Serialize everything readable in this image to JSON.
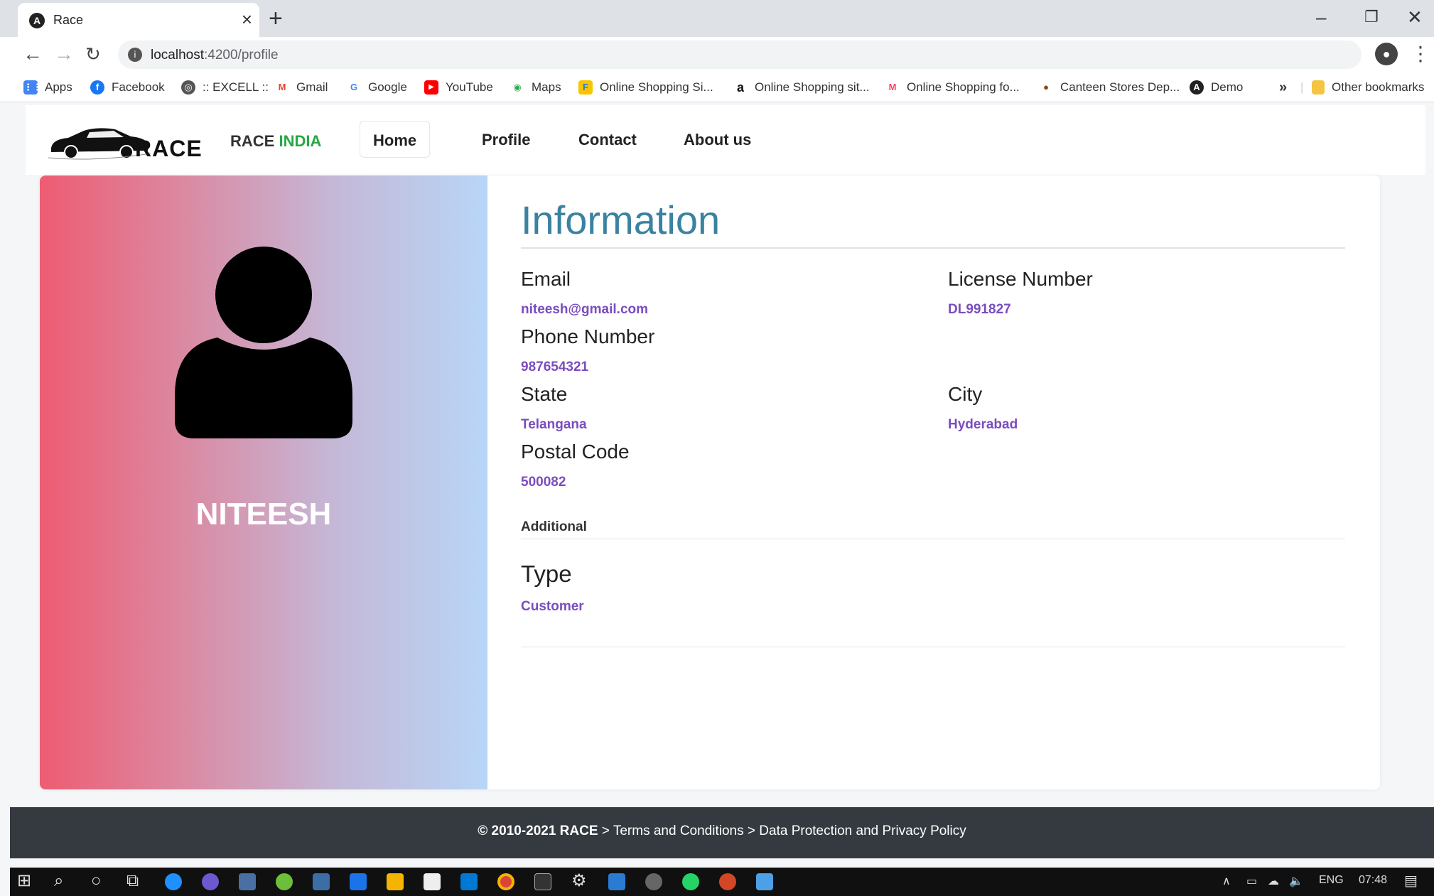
{
  "browser": {
    "tab_title": "Race",
    "tab_favicon": "A",
    "url_host": "localhost",
    "url_path": ":4200/profile",
    "bookmarks": [
      {
        "label": "Apps",
        "icon": "apps-grid-icon",
        "color": "#4285f4",
        "glyph": "⋮⋮"
      },
      {
        "label": "Facebook",
        "icon": "facebook-icon",
        "color": "#1877f2",
        "glyph": "f"
      },
      {
        "label": ":: EXCELL ::",
        "icon": "globe-icon",
        "color": "#555555",
        "glyph": "◎"
      },
      {
        "label": "Gmail",
        "icon": "gmail-icon",
        "color": "#ea4335",
        "glyph": "M"
      },
      {
        "label": "Google",
        "icon": "google-icon",
        "color": "#4285f4",
        "glyph": "G"
      },
      {
        "label": "YouTube",
        "icon": "youtube-icon",
        "color": "#ff0000",
        "glyph": "▶"
      },
      {
        "label": "Maps",
        "icon": "maps-icon",
        "color": "#34a853",
        "glyph": "◉"
      },
      {
        "label": "Online Shopping Si...",
        "icon": "flipkart-icon",
        "color": "#f7c600",
        "glyph": "F"
      },
      {
        "label": "Online Shopping sit...",
        "icon": "amazon-icon",
        "color": "#111111",
        "glyph": "a"
      },
      {
        "label": "Online Shopping fo...",
        "icon": "myntra-icon",
        "color": "#ff3f6c",
        "glyph": "M"
      },
      {
        "label": "Canteen Stores Dep...",
        "icon": "csd-icon",
        "color": "#8b4513",
        "glyph": "●"
      },
      {
        "label": "Demo",
        "icon": "angular-icon",
        "color": "#222222",
        "glyph": "A"
      }
    ],
    "bookmarks_overflow": "»",
    "other_bookmarks": "Other bookmarks"
  },
  "app": {
    "logo_text": "RACE",
    "brand_prefix": "RACE",
    "brand_accent": "INDIA",
    "nav": [
      {
        "label": "Home",
        "active": true
      },
      {
        "label": "Profile",
        "active": false
      },
      {
        "label": "Contact",
        "active": false
      },
      {
        "label": "About us",
        "active": false
      }
    ]
  },
  "profile": {
    "name": "NITEESH",
    "section_title": "Information",
    "fields": {
      "email_label": "Email",
      "email_value": "niteesh@gmail.com",
      "license_label": "License Number",
      "license_value": "DL991827",
      "phone_label": "Phone Number",
      "phone_value": "987654321",
      "state_label": "State",
      "state_value": "Telangana",
      "city_label": "City",
      "city_value": "Hyderabad",
      "postal_label": "Postal Code",
      "postal_value": "500082"
    },
    "additional_title": "Additional",
    "type_label": "Type",
    "type_value": "Customer"
  },
  "footer": {
    "copyright": "© 2010-2021 RACE",
    "link1": "Terms and Conditions",
    "link2": "Data Protection and Privacy Policy",
    "separator": ">"
  },
  "taskbar": {
    "language": "ENG",
    "time": "07:48"
  },
  "colors": {
    "info_title": "#3a82a0",
    "value_text": "#7a4dbd",
    "brand_accent": "#28a745",
    "footer_bg": "#343a40",
    "gradient_start": "#ee5c72",
    "gradient_end": "#b8d6f7"
  }
}
